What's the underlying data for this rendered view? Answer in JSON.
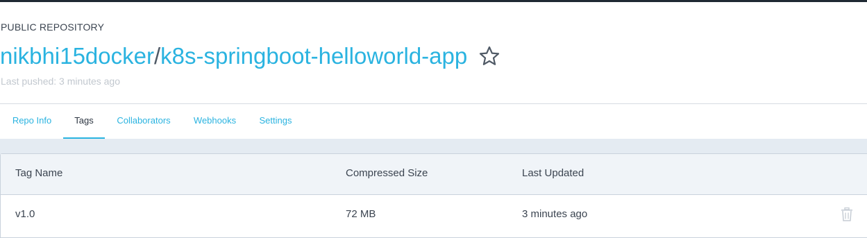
{
  "repository": {
    "visibility": "PUBLIC REPOSITORY",
    "namespace": "nikbhi15docker",
    "separator": "/",
    "name": "k8s-springboot-helloworld-app",
    "last_pushed": "Last pushed: 3 minutes ago",
    "star_icon": "star-outline-icon"
  },
  "tabs": [
    {
      "label": "Repo Info",
      "active": false
    },
    {
      "label": "Tags",
      "active": true
    },
    {
      "label": "Collaborators",
      "active": false
    },
    {
      "label": "Webhooks",
      "active": false
    },
    {
      "label": "Settings",
      "active": false
    }
  ],
  "tags_table": {
    "columns": [
      "Tag Name",
      "Compressed Size",
      "Last Updated"
    ],
    "rows": [
      {
        "tag": "v1.0",
        "size": "72 MB",
        "updated": "3 minutes ago",
        "action_icon": "trash-icon"
      }
    ]
  },
  "colors": {
    "accent": "#2ab3e0",
    "text": "#3b4450",
    "muted": "#c2c8cf",
    "content_bg": "#e4ebf2"
  }
}
